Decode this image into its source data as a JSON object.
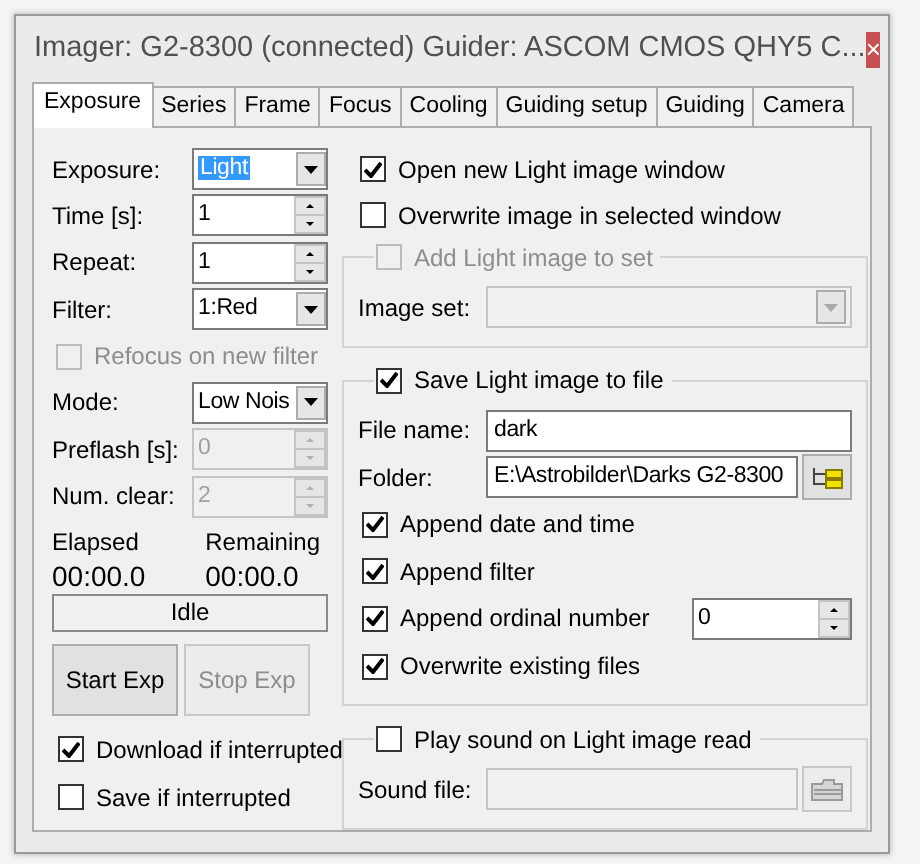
{
  "window": {
    "title": "Imager: G2-8300 (connected) Guider: ASCOM CMOS QHY5 C...",
    "close": "×"
  },
  "tabs": [
    {
      "label": "Exposure",
      "selected": true
    },
    {
      "label": "Series",
      "selected": false
    },
    {
      "label": "Frame",
      "selected": false
    },
    {
      "label": "Focus",
      "selected": false
    },
    {
      "label": "Cooling",
      "selected": false
    },
    {
      "label": "Guiding setup",
      "selected": false
    },
    {
      "label": "Guiding",
      "selected": false
    },
    {
      "label": "Camera",
      "selected": false
    }
  ],
  "left": {
    "fields": [
      {
        "kind": "combo",
        "label": "Exposure:",
        "value": "Light",
        "highlighted": true,
        "disabled": false
      },
      {
        "kind": "spin",
        "label": "Time [s]:",
        "value": "1",
        "disabled": false
      },
      {
        "kind": "spin",
        "label": "Repeat:",
        "value": "1",
        "disabled": false
      },
      {
        "kind": "combo",
        "label": "Filter:",
        "value": "1:Red",
        "highlighted": false,
        "disabled": false
      },
      {
        "kind": "checkbox",
        "label": "Refocus on new filter",
        "checked": false,
        "disabled": true
      },
      {
        "kind": "combo",
        "label": "Mode:",
        "value": "Low Nois",
        "highlighted": false,
        "disabled": false
      },
      {
        "kind": "spin",
        "label": "Preflash [s]:",
        "value": "0",
        "disabled": true
      },
      {
        "kind": "spin",
        "label": "Num. clear:",
        "value": "2",
        "disabled": true
      }
    ],
    "timers": [
      {
        "label": "Elapsed",
        "value": "00:00.0"
      },
      {
        "label": "Remaining",
        "value": "00:00.0"
      }
    ],
    "status": "Idle",
    "buttons": [
      {
        "label": "Start Exp",
        "disabled": false
      },
      {
        "label": "Stop Exp",
        "disabled": true
      }
    ],
    "checks": [
      {
        "label": "Download if interrupted",
        "checked": true,
        "disabled": false
      },
      {
        "label": "Save if interrupted",
        "checked": false,
        "disabled": false
      }
    ]
  },
  "right": {
    "checks": [
      {
        "label": "Open new Light image window",
        "checked": true,
        "disabled": false
      },
      {
        "label": "Overwrite image in selected window",
        "checked": false,
        "disabled": false
      }
    ],
    "groups": [
      {
        "header": {
          "label": "Add Light image to set",
          "checked": false,
          "disabled": true
        },
        "items": [
          {
            "kind": "combo",
            "label": "Image set:",
            "disabled": true
          }
        ]
      },
      {
        "header": {
          "label": "Save Light image to file",
          "checked": true,
          "disabled": false
        },
        "items": [
          {
            "kind": "text",
            "label": "File name:",
            "value": "dark",
            "disabled": false
          },
          {
            "kind": "folder",
            "label": "Folder:",
            "value": "E:\\Astrobilder\\Darks G2-8300",
            "disabled": false
          },
          {
            "kind": "checkbox",
            "label": "Append date and time",
            "checked": true,
            "disabled": false
          },
          {
            "kind": "checkbox",
            "label": "Append filter",
            "checked": true,
            "disabled": false
          },
          {
            "kind": "checkbox-spin",
            "label": "Append ordinal number",
            "value": "0",
            "checked": true,
            "disabled": false
          },
          {
            "kind": "checkbox",
            "label": "Overwrite existing files",
            "checked": true,
            "disabled": false
          }
        ]
      },
      {
        "header": {
          "label": "Play sound on Light image read",
          "checked": false,
          "disabled": false
        },
        "items": [
          {
            "kind": "folder",
            "label": "Sound file:",
            "disabled": true
          }
        ]
      }
    ]
  }
}
